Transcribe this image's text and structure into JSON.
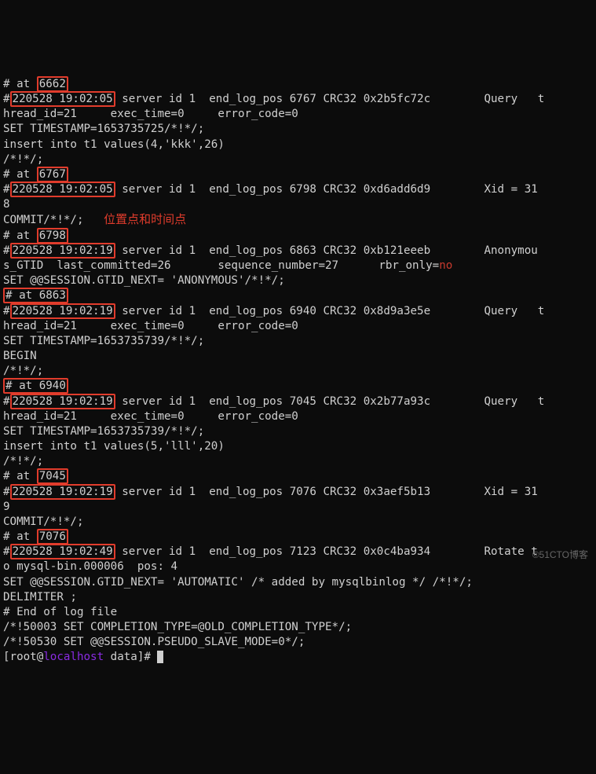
{
  "positions": {
    "p1": "6662",
    "p2": "6767",
    "p3": "6798",
    "p4": "6863",
    "p5": "6940",
    "p6": "7045",
    "p7": "7076"
  },
  "timestamps": {
    "t1": "220528 19:02:05",
    "t2": "220528 19:02:19",
    "t3": "220528 19:02:49"
  },
  "annotation": "位置点和时间点",
  "noflag": "no",
  "host": "localhost",
  "l": {
    "at": "# at ",
    "e1_a": " server id 1  end_log_pos 6767 CRC32 0x2b5fc72c        Query   t",
    "e1_b": "hread_id=21     exec_time=0     error_code=0",
    "e1_c": "SET TIMESTAMP=1653735725/*!*/;",
    "e1_d": "insert into t1 values(4,'kkk',26)",
    "comment": "/*!*/;",
    "e2_a": " server id 1  end_log_pos 6798 CRC32 0xd6add6d9        Xid = 31",
    "e2_b": "8",
    "e2_c": "COMMIT/*!*/;",
    "e3_a": " server id 1  end_log_pos 6863 CRC32 0xb121eeeb        Anonymou",
    "e3_b": "s_GTID  last_committed=26       sequence_number=27      rbr_only=",
    "e3_c": "SET @@SESSION.GTID_NEXT= 'ANONYMOUS'/*!*/;",
    "e4_a": " server id 1  end_log_pos 6940 CRC32 0x8d9a3e5e        Query   t",
    "e4_b": "hread_id=21     exec_time=0     error_code=0",
    "e4_c": "SET TIMESTAMP=1653735739/*!*/;",
    "e4_d": "BEGIN",
    "e5_a": " server id 1  end_log_pos 7045 CRC32 0x2b77a93c        Query   t",
    "e5_b": "hread_id=21     exec_time=0     error_code=0",
    "e5_c": "SET TIMESTAMP=1653735739/*!*/;",
    "e5_d": "insert into t1 values(5,'lll',20)",
    "e6_a": " server id 1  end_log_pos 7076 CRC32 0x3aef5b13        Xid = 31",
    "e6_b": "9",
    "e6_c": "COMMIT/*!*/;",
    "e7_a": " server id 1  end_log_pos 7123 CRC32 0x0c4ba934        Rotate t",
    "e7_b": "o mysql-bin.000006  pos: 4",
    "tail1": "SET @@SESSION.GTID_NEXT= 'AUTOMATIC' /* added by mysqlbinlog */ /*!*/;",
    "tail2": "DELIMITER ;",
    "tail3": "# End of log file",
    "tail4": "/*!50003 SET COMPLETION_TYPE=@OLD_COMPLETION_TYPE*/;",
    "tail5": "/*!50530 SET @@SESSION.PSEUDO_SLAVE_MODE=0*/;",
    "prompt_a": "[root@",
    "prompt_b": " data]# "
  },
  "watermark": "©51CTO博客"
}
